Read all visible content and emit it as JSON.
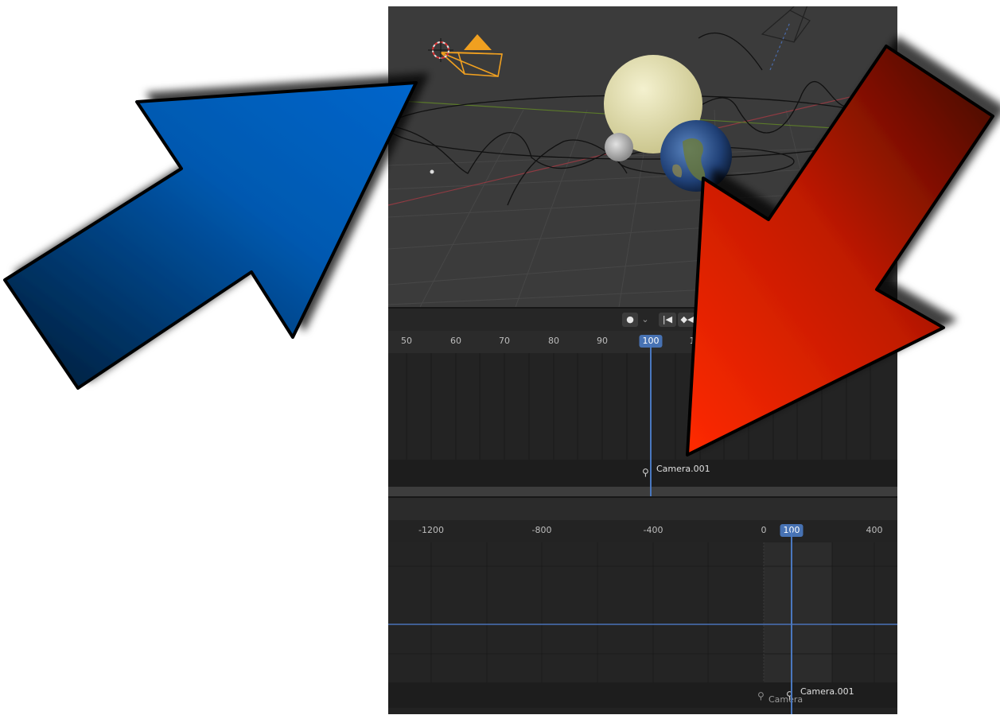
{
  "timeline": {
    "ruler_ticks": [
      "50",
      "60",
      "70",
      "80",
      "90",
      "1"
    ],
    "current_frame": "100",
    "marker_label": "Camera.001",
    "record_button": "●",
    "record_dropdown": "⌄",
    "jump_start": "|◀",
    "prev_keyframe": "◆◀"
  },
  "graph": {
    "ruler_ticks": [
      "-1200",
      "-800",
      "-400",
      "0",
      "400"
    ],
    "current_frame": "100",
    "marker_label": "Camera.001",
    "marker_label_2": "Camera"
  },
  "colors": {
    "accent": "#4772b3",
    "blue_arrow_light": "#0066cc",
    "blue_arrow_dark": "#041a33",
    "red_arrow_light": "#ff2a00",
    "red_arrow_dark": "#3a0600"
  }
}
